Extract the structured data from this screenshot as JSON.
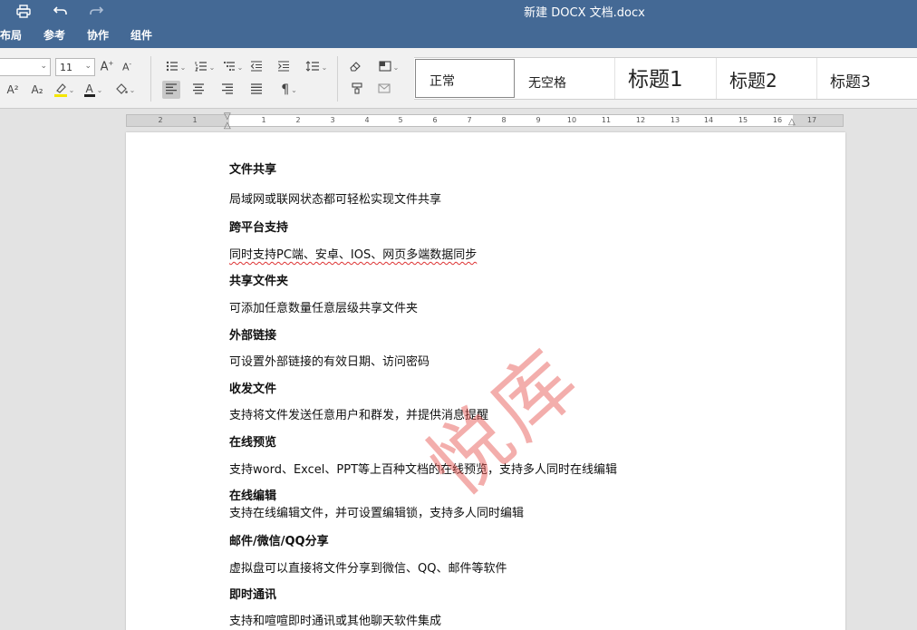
{
  "window": {
    "title": "新建 DOCX 文档.docx"
  },
  "quick_access": {
    "print_icon": "printer-icon",
    "undo_icon": "undo-icon",
    "redo_icon": "redo-icon"
  },
  "menu": [
    "布局",
    "参考",
    "协作",
    "组件"
  ],
  "toolbar": {
    "font_name": "",
    "font_size": "11",
    "grow_font": "A",
    "shrink_font": "A",
    "superscript": "A²",
    "subscript": "A₂",
    "font_color_letter": "A",
    "paragraph_mark": "¶",
    "highlight_color": "#f5e600",
    "font_color": "#e22020"
  },
  "styles": [
    "正常",
    "无空格",
    "标题1",
    "标题2",
    "标题3"
  ],
  "ruler": {
    "left_numbers": [
      "2",
      "1"
    ],
    "right_numbers": [
      "1",
      "2",
      "3",
      "4",
      "5",
      "6",
      "7",
      "8",
      "9",
      "10",
      "11",
      "12",
      "13",
      "14",
      "15",
      "16",
      "17"
    ]
  },
  "document": {
    "lines": [
      {
        "text": "文件共享",
        "heading": true
      },
      {
        "text": "局域网或联网状态都可轻松实现文件共享",
        "heading": false
      },
      {
        "text": "跨平台支持",
        "heading": true
      },
      {
        "text": "同时支持PC端、安卓、IOS、网页多端数据同步",
        "heading": false
      },
      {
        "text": "共享文件夹",
        "heading": true
      },
      {
        "text": "可添加任意数量任意层级共享文件夹",
        "heading": false
      },
      {
        "text": "外部链接",
        "heading": true
      },
      {
        "text": "可设置外部链接的有效日期、访问密码",
        "heading": false
      },
      {
        "text": "收发文件",
        "heading": true
      },
      {
        "text": "支持将文件发送任意用户和群发，并提供消息提醒",
        "heading": false
      },
      {
        "text": "在线预览",
        "heading": true
      },
      {
        "text": "支持word、Excel、PPT等上百种文档的在线预览，支持多人同时在线编辑",
        "heading": false
      },
      {
        "text": "在线编辑",
        "heading": true
      },
      {
        "text": "支持在线编辑文件，并可设置编辑锁，支持多人同时编辑",
        "heading": false
      },
      {
        "text": "邮件/微信/QQ分享",
        "heading": true
      },
      {
        "text": "虚拟盘可以直接将文件分享到微信、QQ、邮件等软件",
        "heading": false
      },
      {
        "text": "即时通讯",
        "heading": true
      },
      {
        "text": "支持和喧喧即时通讯或其他聊天软件集成",
        "heading": false
      }
    ],
    "watermark": "悦库"
  },
  "colors": {
    "titlebar": "#446995",
    "watermark": "#e44b46",
    "spellcheck": "#d33333"
  }
}
